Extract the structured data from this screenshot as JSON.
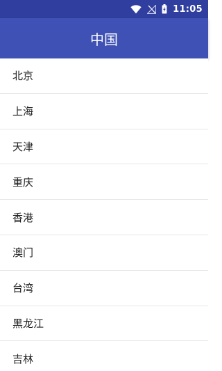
{
  "status_bar": {
    "time": "11:05",
    "icons": [
      "wifi-icon",
      "no-signal-icon",
      "battery-charging-icon"
    ]
  },
  "app_bar": {
    "title": "中国"
  },
  "cities": [
    {
      "label": "北京"
    },
    {
      "label": "上海"
    },
    {
      "label": "天津"
    },
    {
      "label": "重庆"
    },
    {
      "label": "香港"
    },
    {
      "label": "澳门"
    },
    {
      "label": "台湾"
    },
    {
      "label": "黑龙江"
    },
    {
      "label": "吉林"
    }
  ],
  "colors": {
    "status_bar": "#303f9f",
    "app_bar": "#3f51b5",
    "divider": "#e6e6e6"
  }
}
